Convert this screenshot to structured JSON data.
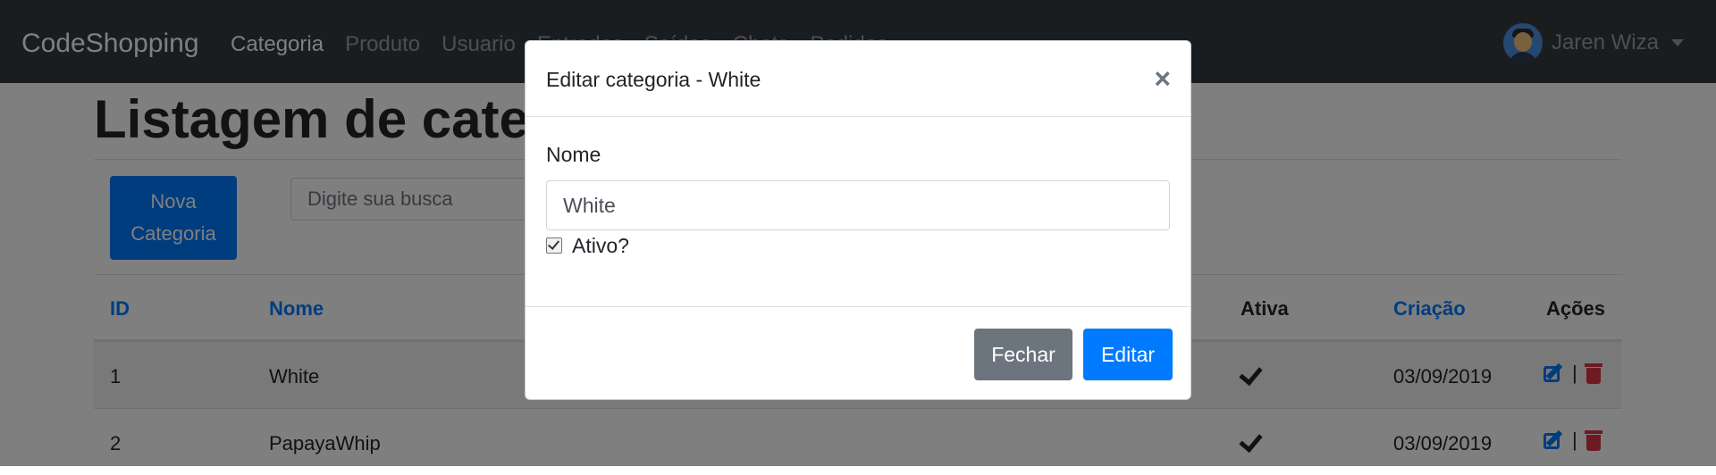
{
  "navbar": {
    "brand": "CodeShopping",
    "links": [
      "Categoria",
      "Produto",
      "Usuario",
      "Entradas",
      "Saídas",
      "Chats",
      "Pedidos"
    ],
    "user": "Jaren Wiza"
  },
  "page": {
    "title": "Listagem de categorias",
    "new_button": "Nova Categoria",
    "search_placeholder": "Digite sua busca"
  },
  "table": {
    "headers": {
      "id": "ID",
      "name": "Nome",
      "active": "Ativa",
      "created": "Criação",
      "actions": "Ações"
    },
    "rows": [
      {
        "id": "1",
        "name": "White",
        "created": "03/09/2019"
      },
      {
        "id": "2",
        "name": "PapayaWhip",
        "created": "03/09/2019"
      }
    ],
    "action_separator": "|"
  },
  "modal": {
    "title": "Editar categoria - White",
    "close_symbol": "×",
    "name_label": "Nome",
    "name_value": "White",
    "active_label": "Ativo?",
    "close_button": "Fechar",
    "edit_button": "Editar"
  },
  "colors": {
    "navbar": "#343a40",
    "primary": "#007bff",
    "secondary": "#6c757d",
    "danger": "#dc3545"
  }
}
